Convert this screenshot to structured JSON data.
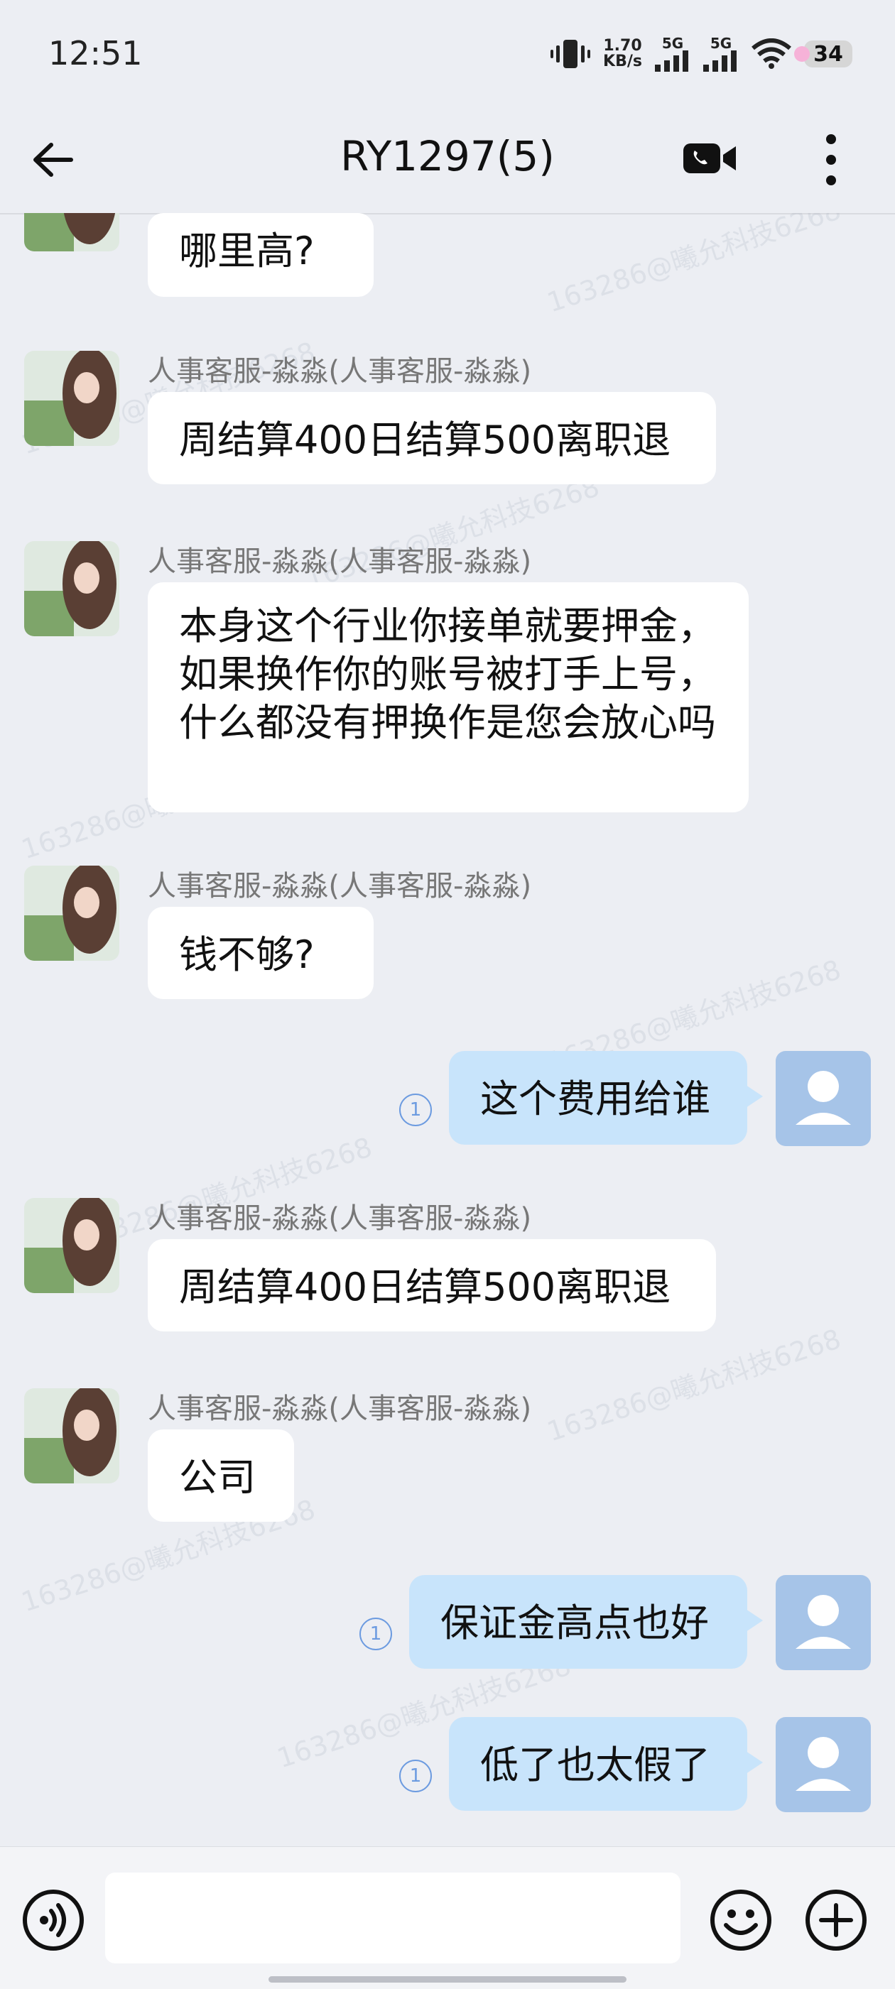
{
  "status_bar": {
    "time": "12:51",
    "net_speed_value": "1.70",
    "net_speed_unit": "KB/s",
    "signal1_label": "5G",
    "signal2_label": "5G",
    "battery": "34"
  },
  "header": {
    "title": "RY1297(5)"
  },
  "messages": [
    {
      "side": "them",
      "sender": "",
      "text": "哪里高?"
    },
    {
      "side": "them",
      "sender": "人事客服-淼淼(人事客服-淼淼)",
      "text": "周结算400日结算500离职退"
    },
    {
      "side": "them",
      "sender": "人事客服-淼淼(人事客服-淼淼)",
      "text": "本身这个行业你接单就要押金，如果换作你的账号被打手上号，什么都没有押换作是您会放心吗"
    },
    {
      "side": "them",
      "sender": "人事客服-淼淼(人事客服-淼淼)",
      "text": "钱不够?"
    },
    {
      "side": "me",
      "text": "这个费用给谁",
      "read_count": "1"
    },
    {
      "side": "them",
      "sender": "人事客服-淼淼(人事客服-淼淼)",
      "text": "周结算400日结算500离职退"
    },
    {
      "side": "them",
      "sender": "人事客服-淼淼(人事客服-淼淼)",
      "text": "公司"
    },
    {
      "side": "me",
      "text": "保证金高点也好",
      "read_count": "1"
    },
    {
      "side": "me",
      "text": "低了也太假了",
      "read_count": "1"
    }
  ],
  "watermark_text": "163286@曦允科技6268",
  "input": {
    "value": "",
    "placeholder": ""
  },
  "icons": {
    "back": "back-arrow-icon",
    "video": "video-call-icon",
    "more": "more-vertical-icon",
    "voice": "voice-input-icon",
    "emoji": "emoji-icon",
    "plus": "plus-icon"
  },
  "colors": {
    "background": "#eceef3",
    "my_bubble": "#c8e4fb",
    "their_bubble": "#ffffff",
    "read_mark": "#6c9be0"
  }
}
